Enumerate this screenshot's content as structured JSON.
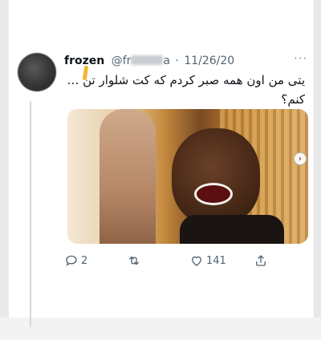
{
  "tweet": {
    "display_name": "frozen",
    "handle_prefix": "@fr",
    "handle_suffix": "a",
    "separator": "·",
    "date": "11/26/20",
    "more_label": "···",
    "text": "یتی من اون همه صبر کردم که کت شلوار تن … کنم؟",
    "media_alt": "crying child photo"
  },
  "actions": {
    "replies": "2",
    "retweets": "",
    "likes": "141",
    "share": ""
  },
  "icons": {
    "reply": "reply-icon",
    "retweet": "retweet-icon",
    "like": "heart-icon",
    "share": "share-icon",
    "more": "more-icon",
    "next": "chevron-right-icon"
  },
  "colors": {
    "text": "#0f1419",
    "secondary": "#536471",
    "thread_line": "#d4d8dc",
    "redaction_mark": "#f2b632"
  }
}
